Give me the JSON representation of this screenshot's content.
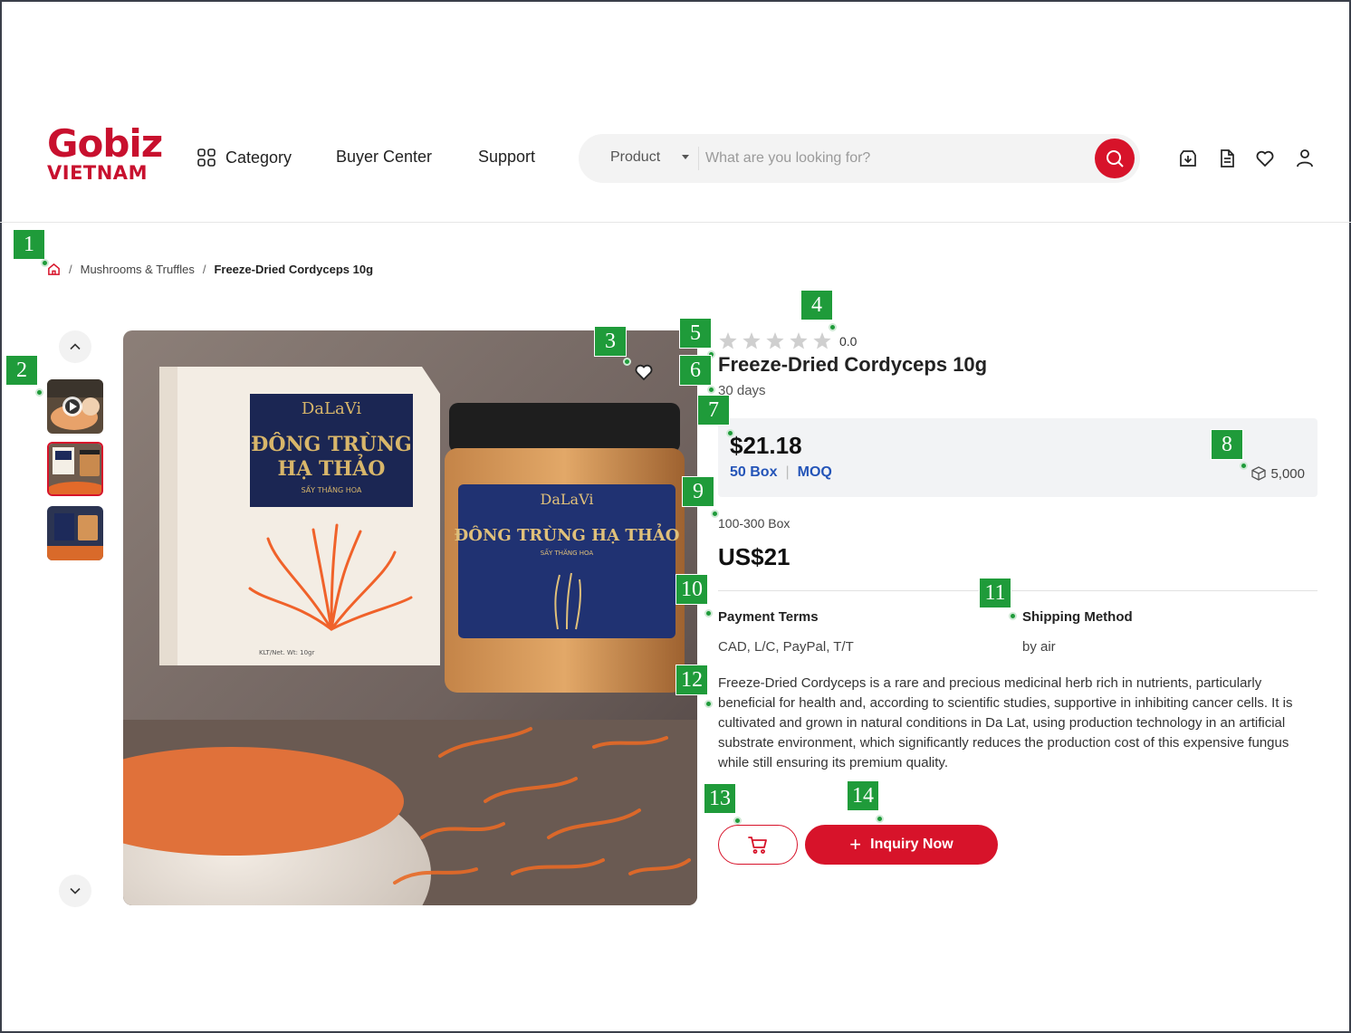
{
  "header": {
    "logo_top": "Gobiz",
    "logo_bottom": "VIETNAM",
    "nav": {
      "category": "Category",
      "buyer_center": "Buyer Center",
      "support": "Support"
    },
    "search": {
      "category": "Product",
      "placeholder": "What are you looking for?"
    },
    "icons": [
      "download-icon",
      "document-icon",
      "heart-icon",
      "user-icon"
    ]
  },
  "breadcrumb": {
    "home_icon": "home-icon",
    "category": "Mushrooms & Truffles",
    "current": "Freeze-Dried Cordyceps 10g"
  },
  "product": {
    "rating": 0,
    "rating_label": "0.0",
    "title": "Freeze-Dried Cordyceps 10g",
    "lead_time": "30 days",
    "price": "$21.18",
    "moq_quantity": "50 Box",
    "moq_label": "MOQ",
    "stock": "5,000",
    "tier_range": "100-300 Box",
    "tier_price": "US$21",
    "payment_label": "Payment Terms",
    "payment_value": "CAD, L/C, PayPal, T/T",
    "shipping_label": "Shipping Method",
    "shipping_value": "by air",
    "description": "Freeze-Dried Cordyceps is a rare and precious medicinal herb rich in nutrients, particularly beneficial for health and, according to scientific studies, supportive in inhibiting cancer cells. It is cultivated and grown in natural conditions in Da Lat, using production technology in an artificial substrate environment, which significantly reduces the production cost of this expensive fungus while still ensuring its premium quality.",
    "inquiry_label": "Inquiry Now"
  },
  "image_text": {
    "brand": "DaLaVi",
    "box_name_1": "ĐÔNG TRÙNG",
    "box_name_2": "HẠ THẢO",
    "box_sub": "SẤY THĂNG HOA",
    "jar_name": "ĐÔNG TRÙNG HẠ THẢO",
    "jar_sub": "SẤY THĂNG HOA",
    "weight": "KLT/Net. Wt: 10gr"
  },
  "markers": [
    "1",
    "2",
    "3",
    "4",
    "5",
    "6",
    "7",
    "8",
    "9",
    "10",
    "11",
    "12",
    "13",
    "14"
  ],
  "colors": {
    "brand_red": "#d7132a",
    "moq_blue": "#2454b8",
    "marker_green": "#1f9b3a"
  }
}
